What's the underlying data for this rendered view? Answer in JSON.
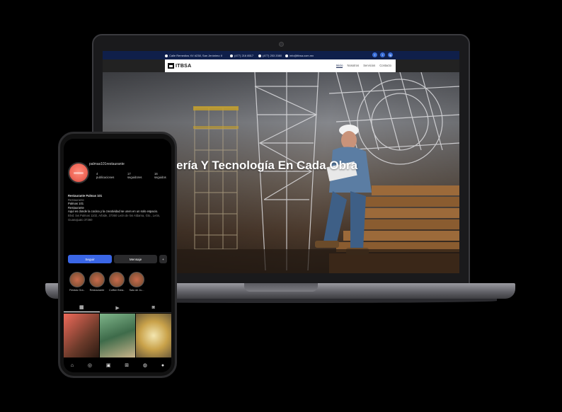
{
  "laptop": {
    "topbar": {
      "address": "Calle Remedios XV #238, San Jerónimo II",
      "phone1": "(477) 216 8517",
      "phone2": "(477) 253 2080",
      "email": "info@itbsa.com.mx"
    },
    "social": [
      "f",
      "t",
      "ig"
    ],
    "logo_text": "ITBSA",
    "menu": [
      "Inicio",
      "Nosotros",
      "Servicios",
      "Contacto"
    ],
    "hero_title": "ería Y Tecnología En Cada Obra"
  },
  "phone": {
    "username": "palmas101restaurante",
    "stats": [
      {
        "count": "4",
        "label": "publicaciones"
      },
      {
        "count": "17",
        "label": "seguidores"
      },
      {
        "count": "16",
        "label": "seguidos"
      }
    ],
    "bio": {
      "name": "Restaurante Palmas 101",
      "category": "Restaurante",
      "line1": "Palmas 101",
      "line2": "Restaurante",
      "line3": "Aquí es donde la cocina y la creatividad se unen en un solo espacio.",
      "address": "Blvd. las Palmas 1102, Arbide, 37360 León de los Aldama, Gto., León, Guanajuato 37360"
    },
    "buttons": {
      "follow": "Seguir",
      "message": "Mensaje",
      "more": "+"
    },
    "highlights": [
      "Fiestas Gra...",
      "Restaurante",
      "Coffee Brea...",
      "Salu de Ju..."
    ],
    "colors": {
      "follow": "#3a66e6",
      "brand": "#0f1f4a",
      "avatar": "#f06a5a"
    }
  }
}
